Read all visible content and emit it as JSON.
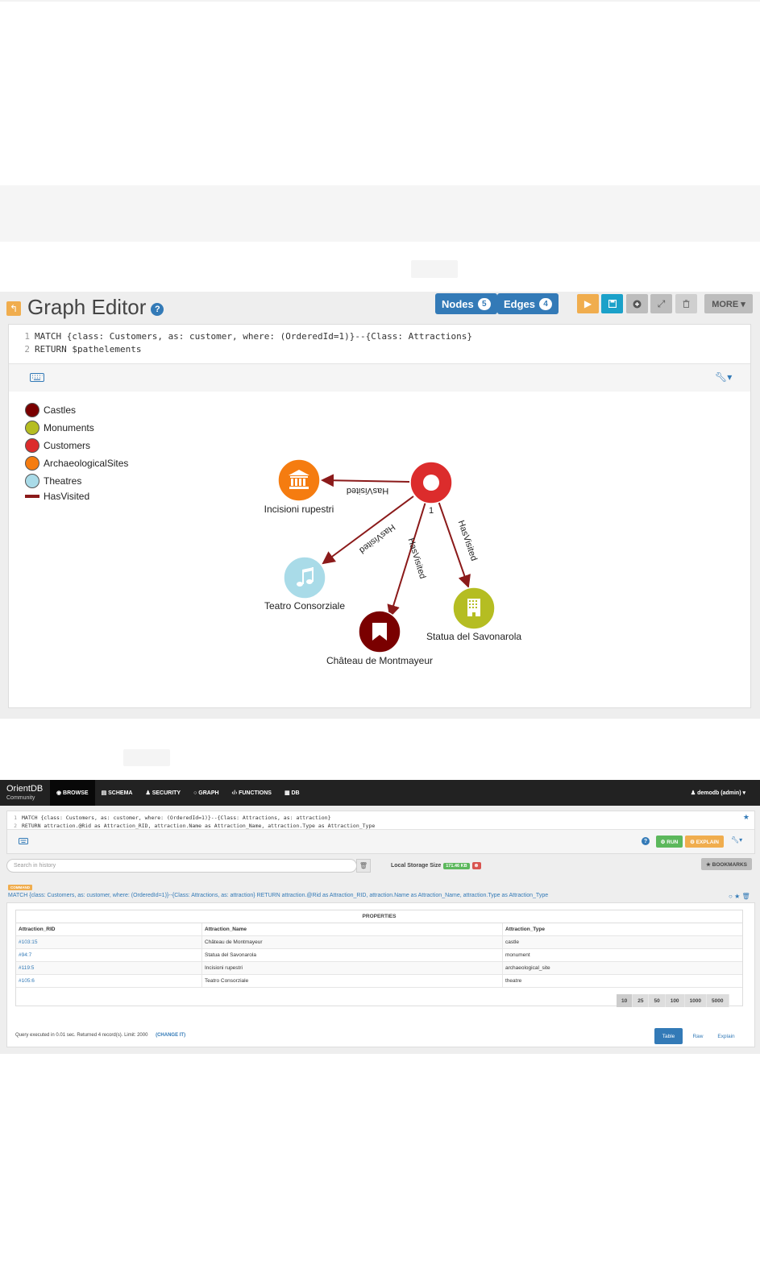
{
  "graph_editor": {
    "title": "Graph Editor",
    "help": "?",
    "nodes_label": "Nodes",
    "nodes_count": "5",
    "edges_label": "Edges",
    "edges_count": "4",
    "more_label": "MORE ▾",
    "query_lines": [
      {
        "n": "1",
        "text": "MATCH {class: Customers, as: customer, where: (OrderedId=1)}--{Class: Attractions}"
      },
      {
        "n": "2",
        "text": "RETURN $pathelements"
      }
    ],
    "legend": [
      {
        "label": "Castles",
        "color": "#7a0000"
      },
      {
        "label": "Monuments",
        "color": "#b5bd22"
      },
      {
        "label": "Customers",
        "color": "#dc2c2c"
      },
      {
        "label": "ArchaeologicalSites",
        "color": "#f57c10"
      },
      {
        "label": "Theatres",
        "color": "#a9dbe8"
      },
      {
        "label": "HasVisited",
        "color": "#8b1a1a"
      }
    ],
    "nodes": [
      {
        "label": "1",
        "icon": "circle-icon"
      },
      {
        "label": "Incisioni rupestri",
        "icon": "landmark-icon"
      },
      {
        "label": "Teatro Consorziale",
        "icon": "music-note-icon"
      },
      {
        "label": "Château de Montmayeur",
        "icon": "bookmark-icon"
      },
      {
        "label": "Statua del Savonarola",
        "icon": "building-icon"
      }
    ],
    "edge_label": "HasVisited"
  },
  "studio": {
    "logo": "OrientDB",
    "logo_sub": "Community",
    "nav": [
      "◉ BROWSE",
      "▤ SCHEMA",
      "♟ SECURITY",
      "○ GRAPH",
      "‹/› FUNCTIONS",
      "▦ DB"
    ],
    "user": "♟ demodb (admin) ▾",
    "query_lines": [
      {
        "n": "1",
        "text": "MATCH {class: Customers, as: customer, where: (OrderedId=1)}--{Class: Attractions, as: attraction}"
      },
      {
        "n": "2",
        "text": "RETURN attraction.@Rid as Attraction_RID, attraction.Name as Attraction_Name, attraction.Type as Attraction_Type"
      }
    ],
    "run_label": "⚙ RUN",
    "explain_label": "⚙ EXPLAIN",
    "history_placeholder": "Search in history",
    "storage_label": "Local Storage Size",
    "storage_value": "171.46 KB",
    "bookmarks_label": "★ BOOKMARKS",
    "command_badge": "COMMAND",
    "command_text": "MATCH {class: Customers, as: customer, where: (OrderedId=1)}--{Class: Attractions, as: attraction} RETURN attraction.@Rid as Attraction_RID, attraction.Name as Attraction_Name, attraction.Type as Attraction_Type",
    "properties_label": "PROPERTIES",
    "columns": [
      "Attraction_RID",
      "Attraction_Name",
      "Attraction_Type"
    ],
    "rows": [
      [
        "#103:15",
        "Château de Montmayeur",
        "castle"
      ],
      [
        "#94:7",
        "Statua del Savonarola",
        "monument"
      ],
      [
        "#119:5",
        "Incisioni rupestri",
        "archaeological_site"
      ],
      [
        "#105:6",
        "Teatro Consorziale",
        "theatre"
      ]
    ],
    "page_sizes": [
      "10",
      "25",
      "50",
      "100",
      "1000",
      "5000"
    ],
    "exec_text": "Query executed in 0.01 sec. Returned 4 record(s). Limit: 2000",
    "change_label": "(CHANGE IT)",
    "view_tabs": [
      "Table",
      "Raw",
      "Explain"
    ]
  }
}
